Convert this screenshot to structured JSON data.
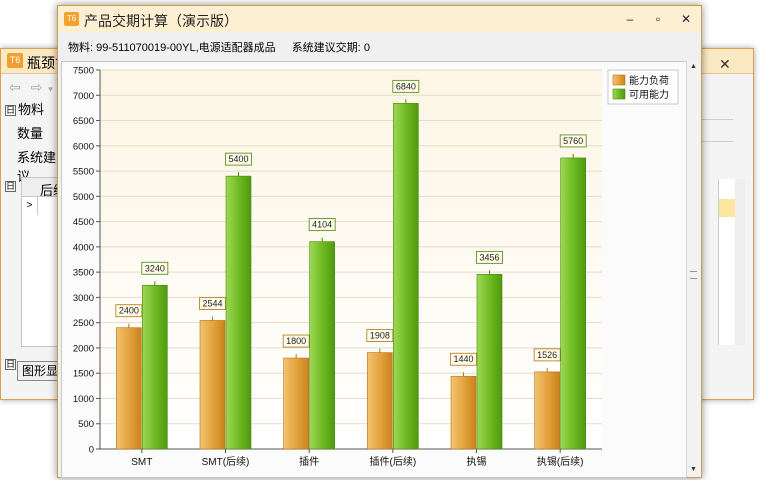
{
  "background_window": {
    "title": "瓶颈岔",
    "close_glyph": "✕",
    "nav": [
      "⇦",
      "⇨",
      "▾"
    ],
    "fields": {
      "material": "物料",
      "quantity": "数量",
      "suggestion": "系统建议"
    },
    "section_toggle": "日",
    "grid_header": "后续",
    "row_marker": ">",
    "button_label": "图形显"
  },
  "window": {
    "title": "产品交期计算（演示版）",
    "logo_text": "T6",
    "minimize_glyph": "–",
    "maximize_glyph": "▫",
    "close_glyph": "✕"
  },
  "info": {
    "material_label": "物料: ",
    "material_value": "99-511070019-00YL,电源适配器成品",
    "delivery_label": "系统建议交期: ",
    "delivery_value": "0"
  },
  "scrollbar": {
    "up": "▲",
    "down": "▼"
  },
  "chart_data": {
    "type": "bar",
    "title": "",
    "xlabel": "",
    "ylabel": "",
    "categories": [
      "SMT",
      "SMT(后续)",
      "插件",
      "插件(后续)",
      "执锡",
      "执锡(后续)"
    ],
    "series": [
      {
        "name": "能力负荷",
        "values": [
          2400,
          2544,
          1800,
          1908,
          1440,
          1526
        ],
        "color": "#e2a13c"
      },
      {
        "name": "可用能力",
        "values": [
          3240,
          5400,
          4104,
          6840,
          3456,
          5760
        ],
        "color": "#6cb81f"
      }
    ],
    "ylim": [
      0,
      7500
    ],
    "yticks": [
      0,
      500,
      1000,
      1500,
      2000,
      2500,
      3000,
      3500,
      4000,
      4500,
      5000,
      5500,
      6000,
      6500,
      7000,
      7500
    ],
    "legend_position": "top-right",
    "data_labels": true,
    "grid": true
  }
}
